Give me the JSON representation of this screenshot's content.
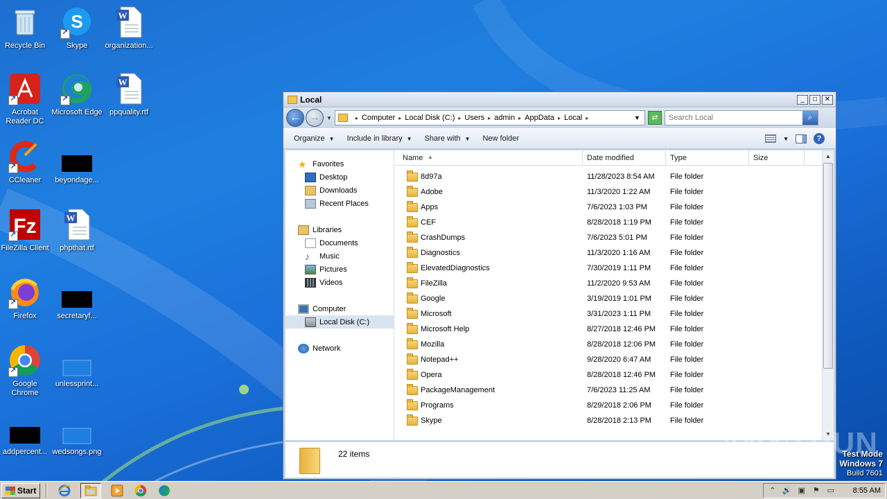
{
  "desktop": {
    "icons": [
      {
        "label": "Recycle Bin"
      },
      {
        "label": "Skype"
      },
      {
        "label": "organization..."
      },
      {
        "label": "Acrobat Reader DC"
      },
      {
        "label": "Microsoft Edge"
      },
      {
        "label": "ppquality.rtf"
      },
      {
        "label": "CCleaner"
      },
      {
        "label": "beyondage..."
      },
      {
        "label": "FileZilla Client"
      },
      {
        "label": "phpthat.rtf"
      },
      {
        "label": "Firefox"
      },
      {
        "label": "secretaryf..."
      },
      {
        "label": "Google Chrome"
      },
      {
        "label": "unlessprint..."
      },
      {
        "label": "addpercent..."
      },
      {
        "label": "wedsongs.png"
      }
    ]
  },
  "window": {
    "title": "Local",
    "minimize": "_",
    "maximize": "□",
    "close": "✕",
    "breadcrumbs": [
      "Computer",
      "Local Disk (C:)",
      "Users",
      "admin",
      "AppData",
      "Local"
    ],
    "search_placeholder": "Search Local",
    "toolbar": {
      "organize": "Organize",
      "include": "Include in library",
      "share": "Share with",
      "newfolder": "New folder"
    },
    "nav": {
      "favorites": "Favorites",
      "desktop": "Desktop",
      "downloads": "Downloads",
      "recent": "Recent Places",
      "libraries": "Libraries",
      "documents": "Documents",
      "music": "Music",
      "pictures": "Pictures",
      "videos": "Videos",
      "computer": "Computer",
      "localdisk": "Local Disk (C:)",
      "network": "Network"
    },
    "columns": {
      "name": "Name",
      "date": "Date modified",
      "type": "Type",
      "size": "Size"
    },
    "files": [
      {
        "name": "8d97a",
        "date": "11/28/2023 8:54 AM",
        "type": "File folder"
      },
      {
        "name": "Adobe",
        "date": "11/3/2020 1:22 AM",
        "type": "File folder"
      },
      {
        "name": "Apps",
        "date": "7/6/2023 1:03 PM",
        "type": "File folder"
      },
      {
        "name": "CEF",
        "date": "8/28/2018 1:19 PM",
        "type": "File folder"
      },
      {
        "name": "CrashDumps",
        "date": "7/6/2023 5:01 PM",
        "type": "File folder"
      },
      {
        "name": "Diagnostics",
        "date": "11/3/2020 1:16 AM",
        "type": "File folder"
      },
      {
        "name": "ElevatedDiagnostics",
        "date": "7/30/2019 1:11 PM",
        "type": "File folder"
      },
      {
        "name": "FileZilla",
        "date": "11/2/2020 9:53 AM",
        "type": "File folder"
      },
      {
        "name": "Google",
        "date": "3/19/2019 1:01 PM",
        "type": "File folder"
      },
      {
        "name": "Microsoft",
        "date": "3/31/2023 1:11 PM",
        "type": "File folder"
      },
      {
        "name": "Microsoft Help",
        "date": "8/27/2018 12:46 PM",
        "type": "File folder"
      },
      {
        "name": "Mozilla",
        "date": "8/28/2018 12:06 PM",
        "type": "File folder"
      },
      {
        "name": "Notepad++",
        "date": "9/28/2020 6:47 AM",
        "type": "File folder"
      },
      {
        "name": "Opera",
        "date": "8/28/2018 12:46 PM",
        "type": "File folder"
      },
      {
        "name": "PackageManagement",
        "date": "7/6/2023 11:25 AM",
        "type": "File folder"
      },
      {
        "name": "Programs",
        "date": "8/29/2018 2:06 PM",
        "type": "File folder"
      },
      {
        "name": "Skype",
        "date": "8/28/2018 2:13 PM",
        "type": "File folder"
      }
    ],
    "item_count": "22 items"
  },
  "taskbar": {
    "start": "Start",
    "clock": "8:55 AM"
  },
  "watermark": "ANY▷RUN",
  "testmode": {
    "line1": "Test Mode",
    "line2": "Windows 7",
    "line3": "Build 7601"
  }
}
